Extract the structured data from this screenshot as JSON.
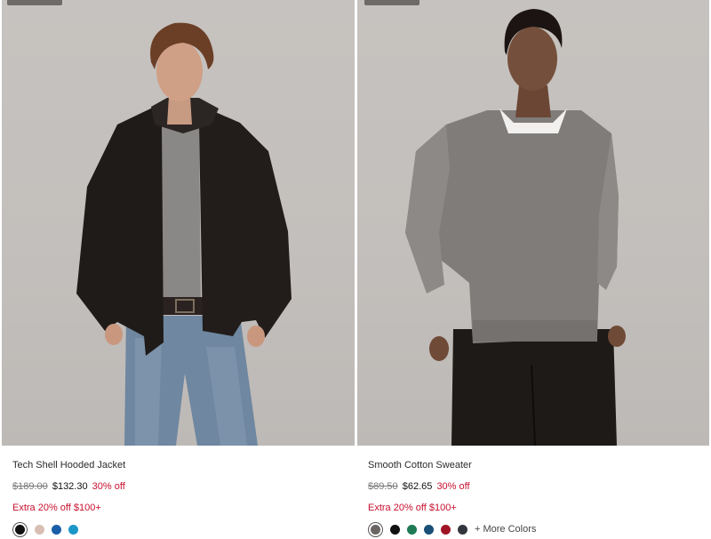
{
  "products": [
    {
      "title": "Tech Shell Hooded Jacket",
      "original_price": "$189.00",
      "sale_price": "$132.30",
      "discount": "30% off",
      "promo": "Extra 20% off $100+",
      "swatches": [
        {
          "color": "#111111",
          "selected": true
        },
        {
          "color": "#d9bfb3",
          "selected": false
        },
        {
          "color": "#1a5ea8",
          "selected": false
        },
        {
          "color": "#1b97c9",
          "selected": false
        }
      ]
    },
    {
      "title": "Smooth Cotton Sweater",
      "original_price": "$89.50",
      "sale_price": "$62.65",
      "discount": "30% off",
      "promo": "Extra 20% off $100+",
      "swatches": [
        {
          "color": "#6b6664",
          "selected": true
        },
        {
          "color": "#111111",
          "selected": false
        },
        {
          "color": "#1e7a55",
          "selected": false
        },
        {
          "color": "#1a4f78",
          "selected": false
        },
        {
          "color": "#a01526",
          "selected": false
        },
        {
          "color": "#33353d",
          "selected": false
        }
      ],
      "more_colors": "+ More Colors"
    }
  ]
}
